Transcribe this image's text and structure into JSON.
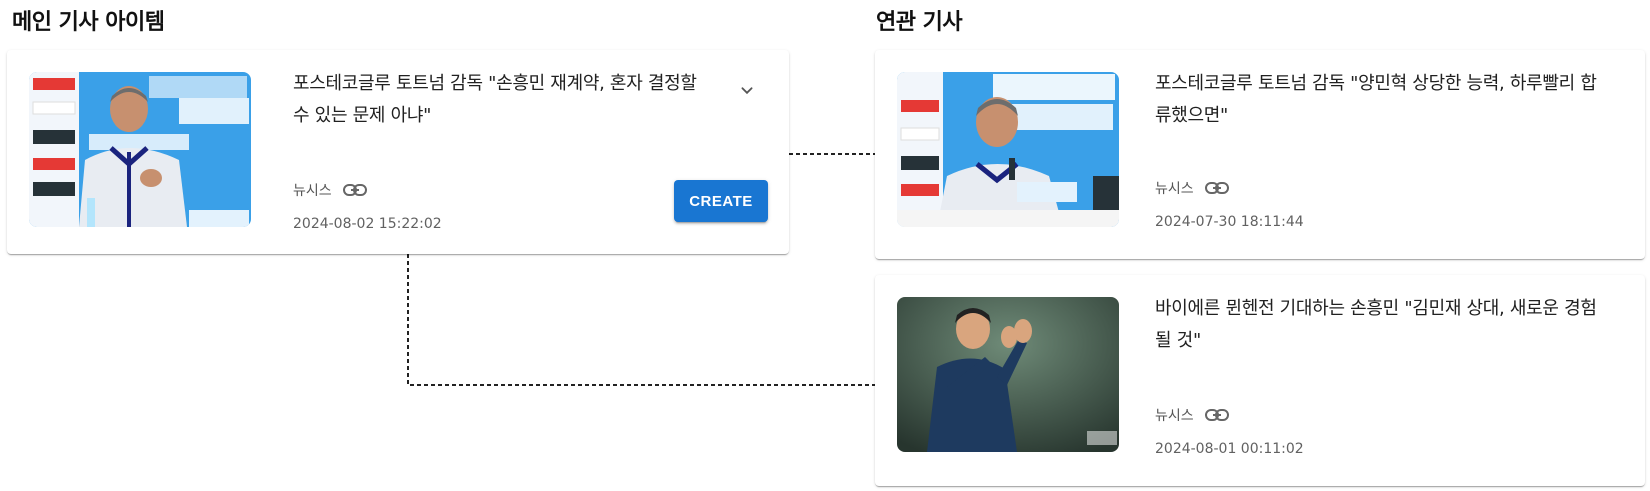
{
  "sections": {
    "main_title": "메인 기사 아이템",
    "related_title": "연관 기사"
  },
  "main_article": {
    "title": "포스테코글루 토트넘 감독 \"손흥민 재계약, 혼자 결정할 수 있는 문제 아냐\"",
    "source": "뉴시스",
    "date": "2024-08-02 15:22:02",
    "create_label": "CREATE",
    "image_alt": "포스테코글루 감독 기자회견"
  },
  "related_articles": [
    {
      "title": "포스테코글루 토트넘 감독 \"양민혁 상당한 능력, 하루빨리 합류했으면\"",
      "source": "뉴시스",
      "date": "2024-07-30 18:11:44",
      "image_alt": "포스테코글루 감독 기자회견"
    },
    {
      "title": "바이에른 뮌헨전 기대하는 손흥민 \"김민재 상대, 새로운 경험 될 것\"",
      "source": "뉴시스",
      "date": "2024-08-01 00:11:02",
      "image_alt": "손흥민 박수"
    }
  ],
  "icons": {
    "link": "link-icon",
    "expand": "chevron-down-icon"
  },
  "colors": {
    "accent": "#1976d2",
    "banner_blue": "#3aa0e8",
    "connector": "#222222"
  }
}
